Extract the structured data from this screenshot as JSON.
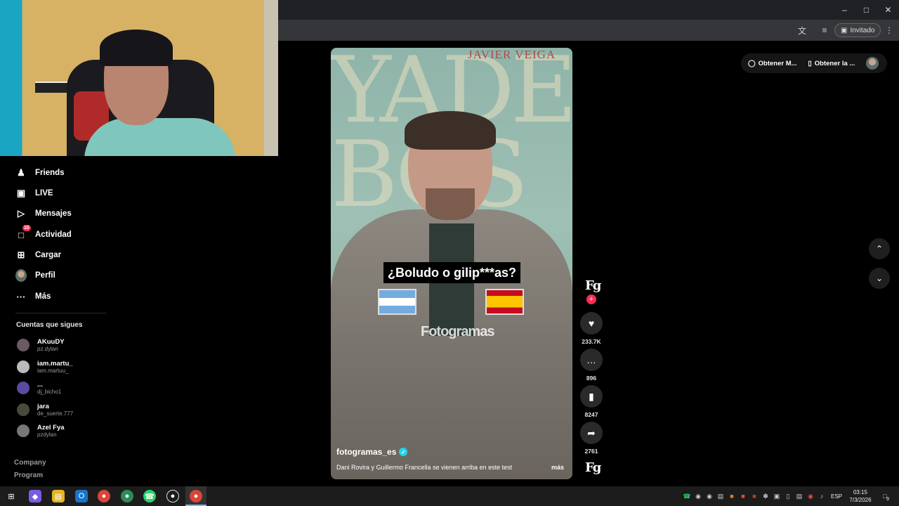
{
  "browser": {
    "guest_label": "Invitado"
  },
  "sidebar": {
    "nav": [
      {
        "label": "Friends",
        "icon": "friends-icon"
      },
      {
        "label": "LIVE",
        "icon": "live-icon"
      },
      {
        "label": "Mensajes",
        "icon": "messages-icon"
      },
      {
        "label": "Actividad",
        "icon": "activity-icon",
        "badge": "10"
      },
      {
        "label": "Cargar",
        "icon": "upload-icon"
      },
      {
        "label": "Perfil",
        "icon": "avatar"
      },
      {
        "label": "Más",
        "icon": "more-icon"
      }
    ],
    "following_title": "Cuentas que sigues",
    "following": [
      {
        "name": "AKuuDY",
        "handle": "pz.dylan"
      },
      {
        "name": "iam.martu_",
        "handle": "iam.martuu_"
      },
      {
        "name": "...",
        "handle": "dj_bicho1"
      },
      {
        "name": "jara",
        "handle": "de_suerte.777"
      },
      {
        "name": "Azel Fya",
        "handle": "pzdylan"
      }
    ],
    "footer_links": [
      "Company",
      "Program"
    ]
  },
  "video": {
    "brand_text": "JAVIER VEIGA",
    "question": "¿Boludo o gilip***as?",
    "watermark": "Fotogramas",
    "author": "fotogramas_es",
    "description": "Dani Rovira y Guillermo Francella se vienen arriba en este test",
    "more_label": "más"
  },
  "actions": {
    "profile_logo": "Fg",
    "likes": "233.7K",
    "comments": "896",
    "saves": "8247",
    "shares": "2761",
    "sound_logo": "Fg"
  },
  "top_pill": {
    "item1": "Obtener M...",
    "item2": "Obtener la ..."
  },
  "taskbar": {
    "lang": "ESP",
    "time": "03:15",
    "date": "7/3/2026",
    "notifications": "9"
  },
  "colors": {
    "accent": "#fe2c55",
    "verified": "#20d5ec",
    "background": "#000000"
  }
}
